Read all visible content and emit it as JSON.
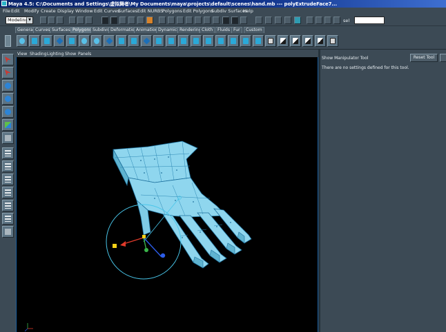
{
  "window": {
    "title": "Maya 4.5: C:\\Documents and Settings\\虚拟舞者\\My Documents\\maya\\projects\\default\\scenes\\hand.mb  ---  polyExtrudeFace7..."
  },
  "menubar": {
    "items": [
      "File",
      "Edit",
      "Modify",
      "Create",
      "Display",
      "Window",
      "Edit Curves",
      "Surfaces",
      "Edit NURBS",
      "Polygons",
      "Edit Polygons",
      "Subdiv Surfaces",
      "Help"
    ]
  },
  "statusline": {
    "mode": "Modeling",
    "sel_label": "sel"
  },
  "shelf": {
    "tabs": [
      "General",
      "Curves",
      "Surfaces",
      "Polygons",
      "Subdivs",
      "Deformation",
      "Animation",
      "Dynamics",
      "Rendering",
      "Cloth",
      "Fluids",
      "Fur",
      "Custom"
    ],
    "active_tab": "Polygons"
  },
  "panel": {
    "menu": [
      "View",
      "Shading",
      "Lighting",
      "Show",
      "Panels"
    ]
  },
  "tool_settings": {
    "title": "Show Manipulator Tool",
    "reset_label": "Reset Tool",
    "message": "There are no settings defined for this tool."
  },
  "colors": {
    "mesh_fill": "#8fd6ee",
    "mesh_edge": "#1c6f9c",
    "manipulator_ring": "#49c6ea",
    "background": "#000000"
  }
}
